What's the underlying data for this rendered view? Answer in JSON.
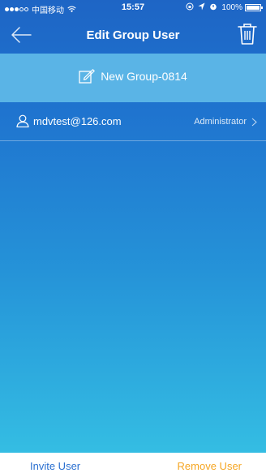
{
  "status_bar": {
    "carrier": "中国移动",
    "time": "15:57",
    "battery": "100%",
    "icons": [
      "signal-icon",
      "wifi-icon",
      "lock-rotation-icon",
      "location-icon",
      "alarm-icon",
      "battery-icon"
    ]
  },
  "nav": {
    "title": "Edit Group User",
    "back_icon": "back-arrow-icon",
    "delete_icon": "trash-icon"
  },
  "group": {
    "name": "New Group-0814",
    "edit_icon": "edit-icon"
  },
  "users": [
    {
      "email": "mdvtest@126.com",
      "role": "Administrator",
      "icon": "user-icon"
    }
  ],
  "actions": {
    "invite_label": "Invite User",
    "remove_label": "Remove User"
  },
  "colors": {
    "gradient_top": "#1e65c5",
    "gradient_bottom": "#34bde3",
    "group_bar": "#5ab4e6",
    "invite": "#2a6fd0",
    "remove": "#f5a623"
  }
}
